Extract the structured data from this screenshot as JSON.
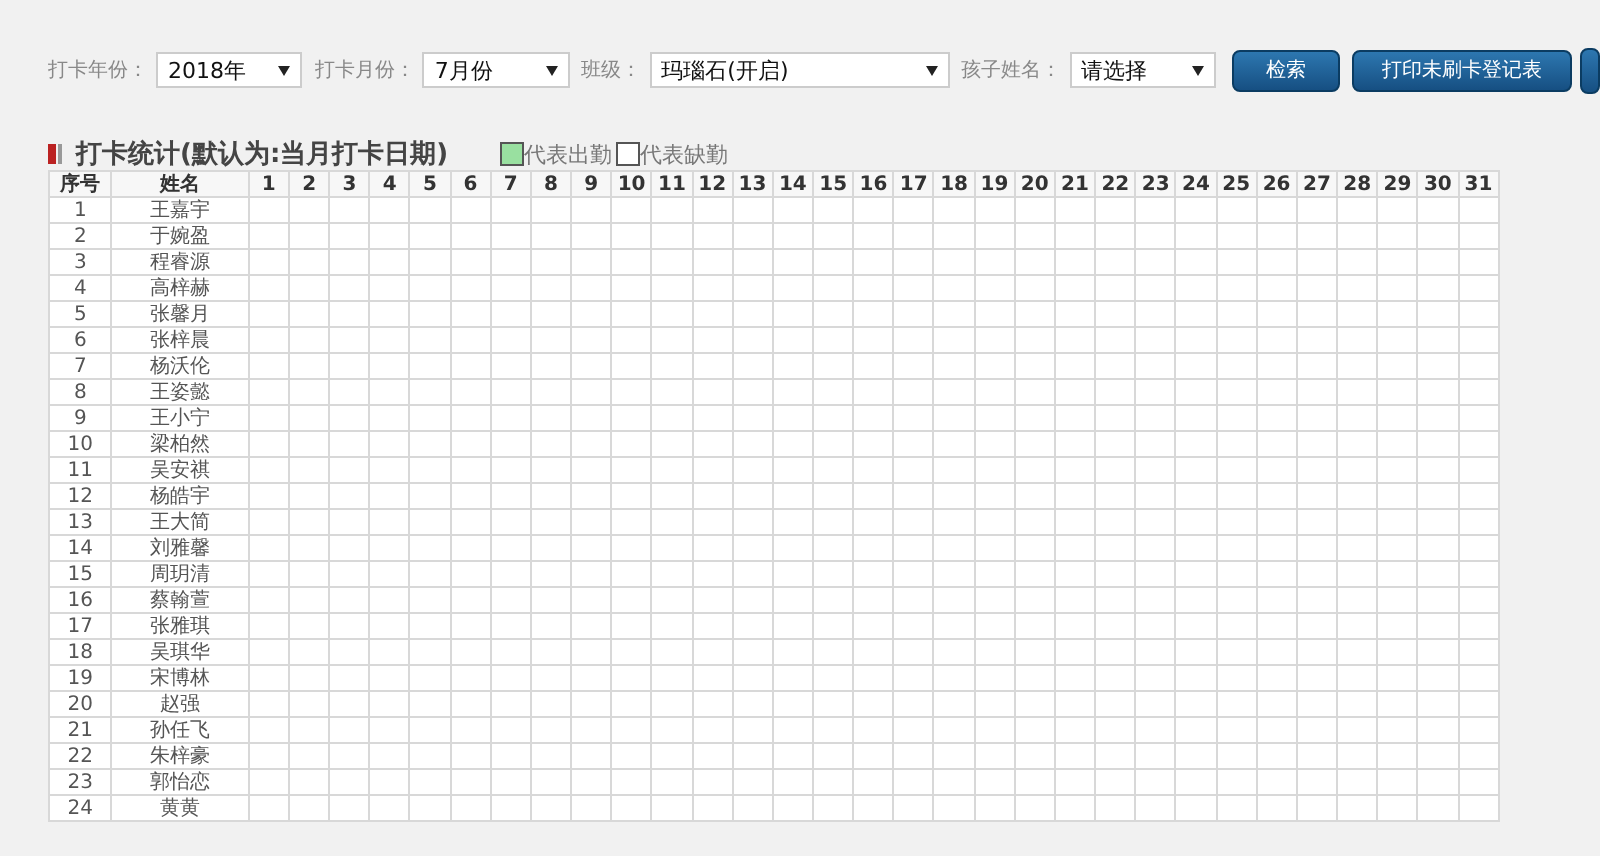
{
  "filters": [
    {
      "label": "打卡年份：",
      "value": "2018年",
      "kind": "narrow"
    },
    {
      "label": "打卡月份：",
      "value": "7月份",
      "kind": "narrow"
    },
    {
      "label": "班级：",
      "value": "玛瑙石(开启)",
      "kind": "wide"
    },
    {
      "label": "孩子姓名：",
      "value": "请选择",
      "kind": "narrow"
    }
  ],
  "buttons": [
    "检索",
    "打印未刷卡登记表"
  ],
  "section": {
    "title": "打卡统计(默认为:当月打卡日期)",
    "legend": [
      {
        "label": "代表出勤",
        "color": "#99e0a0"
      },
      {
        "label": "代表缺勤",
        "color": "#ffffff"
      }
    ]
  },
  "table": {
    "columns": [
      "序号",
      "姓名",
      "1",
      "2",
      "3",
      "4",
      "5",
      "6",
      "7",
      "8",
      "9",
      "10",
      "11",
      "12",
      "13",
      "14",
      "15",
      "16",
      "17",
      "18",
      "19",
      "20",
      "21",
      "22",
      "23",
      "24",
      "25",
      "26",
      "27",
      "28",
      "29",
      "30",
      "31"
    ],
    "rows": [
      [
        "1",
        "王嘉宇"
      ],
      [
        "2",
        "于婉盈"
      ],
      [
        "3",
        "程睿源"
      ],
      [
        "4",
        "高梓赫"
      ],
      [
        "5",
        "张馨月"
      ],
      [
        "6",
        "张梓晨"
      ],
      [
        "7",
        "杨沃伦"
      ],
      [
        "8",
        "王姿懿"
      ],
      [
        "9",
        "王小宁"
      ],
      [
        "10",
        "梁柏然"
      ],
      [
        "11",
        "吴安祺"
      ],
      [
        "12",
        "杨皓宇"
      ],
      [
        "13",
        "王大简"
      ],
      [
        "14",
        "刘雅馨"
      ],
      [
        "15",
        "周玥清"
      ],
      [
        "16",
        "蔡翰萱"
      ],
      [
        "17",
        "张雅琪"
      ],
      [
        "18",
        "吴琪华"
      ],
      [
        "19",
        "宋博林"
      ],
      [
        "20",
        "赵强"
      ],
      [
        "21",
        "孙任飞"
      ],
      [
        "22",
        "朱梓豪"
      ],
      [
        "23",
        "郭怡恋"
      ],
      [
        "24",
        "黄黄"
      ]
    ]
  }
}
